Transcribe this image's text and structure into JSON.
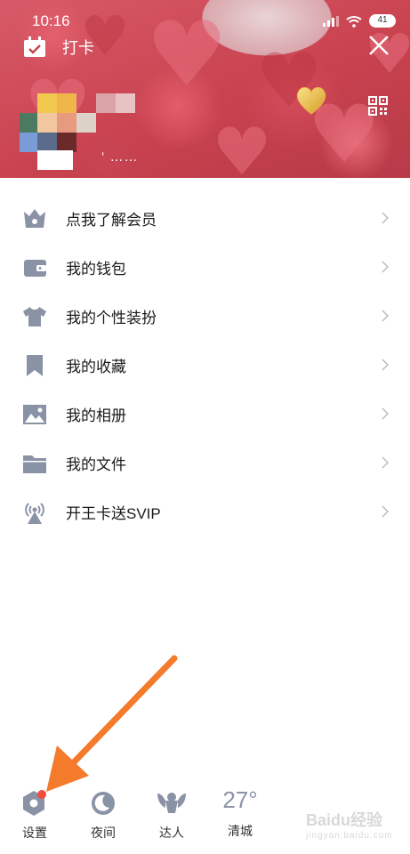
{
  "status": {
    "time": "10:16",
    "battery": "41"
  },
  "header": {
    "checkin_label": "打卡",
    "nickname": "‘ ……"
  },
  "menu": [
    {
      "label": "点我了解会员",
      "icon": "vip-crown-icon"
    },
    {
      "label": "我的钱包",
      "icon": "wallet-icon"
    },
    {
      "label": "我的个性装扮",
      "icon": "shirt-icon"
    },
    {
      "label": "我的收藏",
      "icon": "bookmark-icon"
    },
    {
      "label": "我的相册",
      "icon": "photo-icon"
    },
    {
      "label": "我的文件",
      "icon": "folder-icon"
    },
    {
      "label": "开王卡送SVIP",
      "icon": "antenna-icon"
    }
  ],
  "bottom": {
    "settings": "设置",
    "night": "夜间",
    "expert": "达人",
    "weather_temp": "27°",
    "weather_city": "清城"
  },
  "watermark": {
    "brand": "Baidu经验",
    "url": "jingyan.baidu.com"
  },
  "colors": {
    "icon": "#8a92a6",
    "arrow": "#f47a2c",
    "badge": "#f24b3d",
    "header": "#c9424f"
  }
}
